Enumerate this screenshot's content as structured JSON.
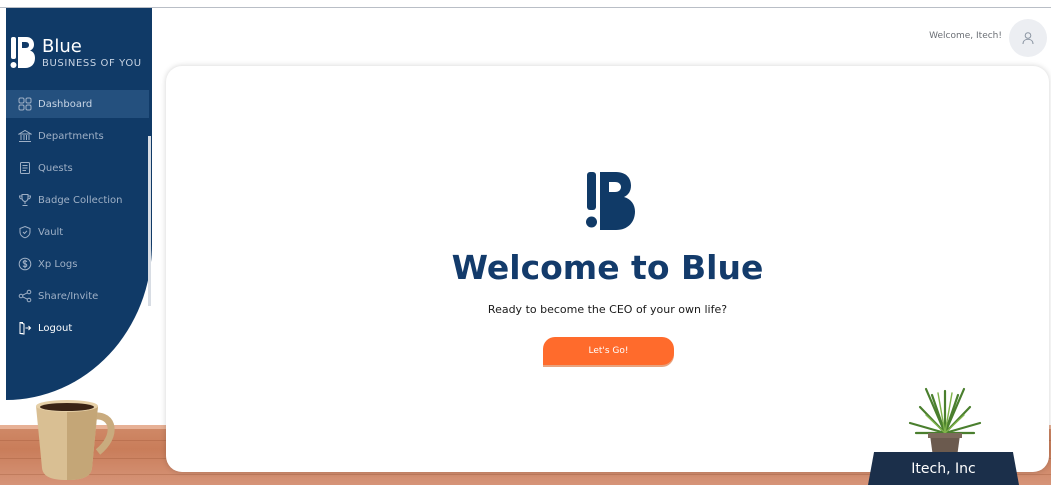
{
  "brand": {
    "name": "Blue",
    "tagline": "BUSINESS OF YOU",
    "primary_color": "#103a67",
    "accent_color": "#ff6b2c"
  },
  "header": {
    "welcome": "Welcome, Itech!",
    "avatar_icon": "user-icon"
  },
  "sidebar": {
    "items": [
      {
        "label": "Dashboard",
        "icon": "grid-icon",
        "active": true
      },
      {
        "label": "Departments",
        "icon": "bank-icon"
      },
      {
        "label": "Quests",
        "icon": "scroll-icon"
      },
      {
        "label": "Badge Collection",
        "icon": "trophy-icon"
      },
      {
        "label": "Vault",
        "icon": "shield-icon"
      },
      {
        "label": "Xp Logs",
        "icon": "dollar-circle-icon"
      },
      {
        "label": "Share/Invite",
        "icon": "share-icon"
      },
      {
        "label": "Logout",
        "icon": "logout-icon"
      }
    ]
  },
  "main": {
    "title": "Welcome to Blue",
    "subtitle": "Ready to become the CEO of your own life?",
    "cta_label": "Let's Go!"
  },
  "desk": {
    "nameplate": "Itech, Inc"
  }
}
